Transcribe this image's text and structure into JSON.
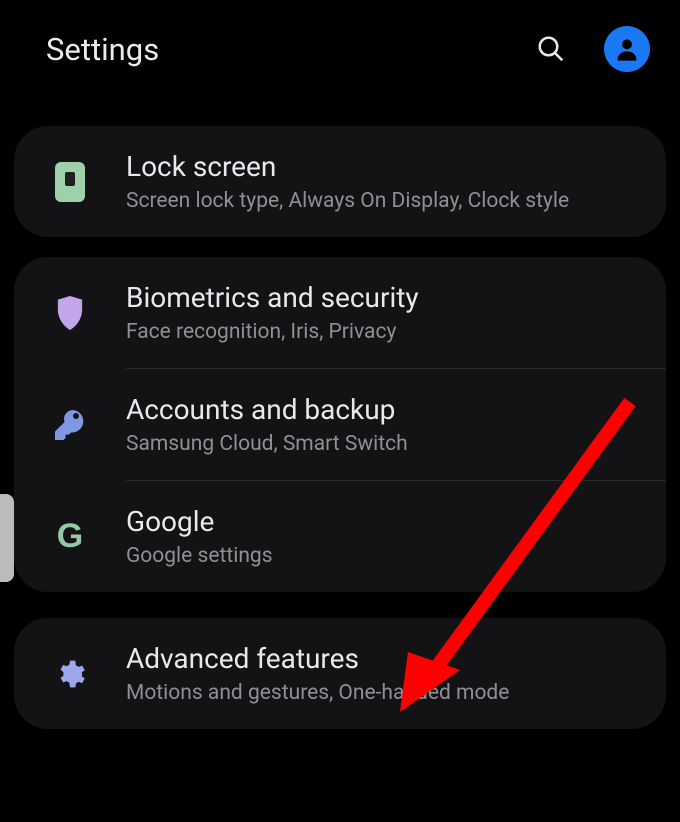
{
  "header": {
    "title": "Settings"
  },
  "groups": [
    {
      "items": [
        {
          "title": "Lock screen",
          "subtitle": "Screen lock type, Always On Display, Clock style"
        }
      ]
    },
    {
      "items": [
        {
          "title": "Biometrics and security",
          "subtitle": "Face recognition, Iris, Privacy"
        },
        {
          "title": "Accounts and backup",
          "subtitle": "Samsung Cloud, Smart Switch"
        },
        {
          "title": "Google",
          "subtitle": "Google settings"
        }
      ]
    },
    {
      "items": [
        {
          "title": "Advanced features",
          "subtitle": "Motions and gestures, One-handed mode"
        }
      ]
    }
  ]
}
